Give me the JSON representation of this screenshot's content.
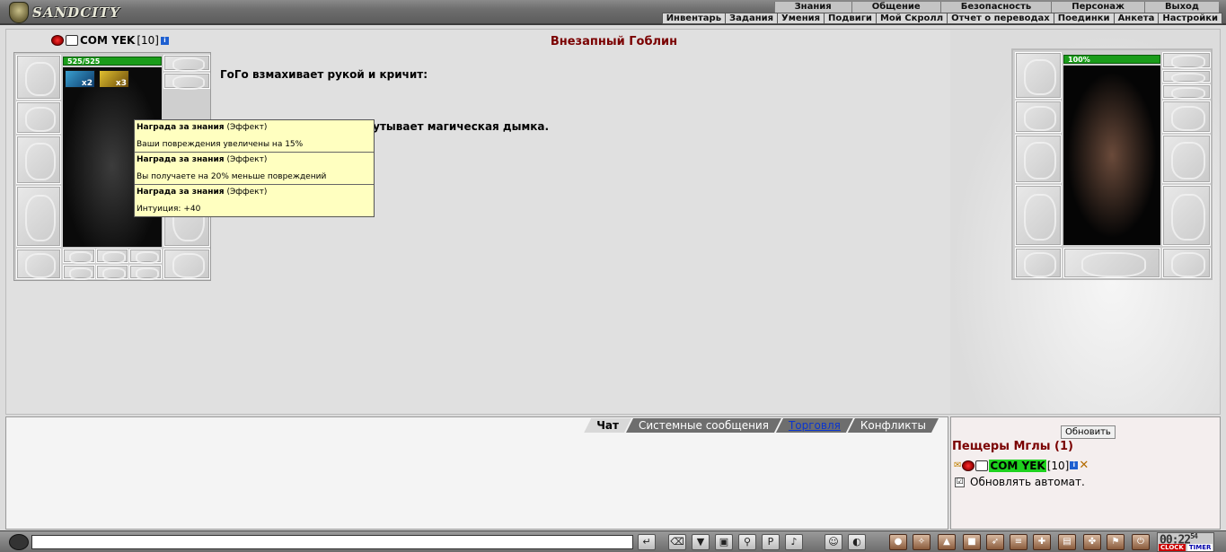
{
  "logo": {
    "text": "SANDCITY"
  },
  "nav": {
    "top": [
      "Знания",
      "Общение",
      "Безопасность",
      "Персонаж",
      "Выход"
    ],
    "sub": [
      "Инвентарь",
      "Задания",
      "Умения",
      "Подвиги",
      "Мой Скролл",
      "Отчет о переводах",
      "Поединки",
      "Анкета",
      "Настройки"
    ]
  },
  "player": {
    "nick": "COM YEK",
    "level": "[10]",
    "hp": "525/525",
    "effect1": "x2",
    "effect2": "x3"
  },
  "enemy": {
    "name": "Внезапный Гоблин",
    "hp": "100%"
  },
  "log": {
    "line1": "ГоГо взмахивает рукой и кричит:",
    "line2": "",
    "line3": "кутывает магическая дымка."
  },
  "tooltip": {
    "items": [
      {
        "title": "Награда за знания",
        "type": "(Эффект)",
        "desc": "Ваши повреждения увеличены на 15%"
      },
      {
        "title": "Награда за знания",
        "type": "(Эффект)",
        "desc": "Вы получаете на 20% меньше повреждений"
      },
      {
        "title": "Награда за знания",
        "type": "(Эффект)",
        "desc": "Интуиция: +40"
      }
    ]
  },
  "chat": {
    "tabs": [
      "Чат",
      "Системные сообщения",
      "Торговля",
      "Конфликты"
    ]
  },
  "location": {
    "refresh": "Обновить",
    "title": "Пещеры Мглы (1)",
    "player_nick": "COM YEK",
    "player_level": "[10]",
    "auto_label": "Обновлять автомат.",
    "auto_checked": "☑"
  },
  "bottom": {
    "clock_time": "00:22",
    "clock_sec": "54",
    "clock_label": "CLOCK",
    "timer_label": "TIMER"
  }
}
